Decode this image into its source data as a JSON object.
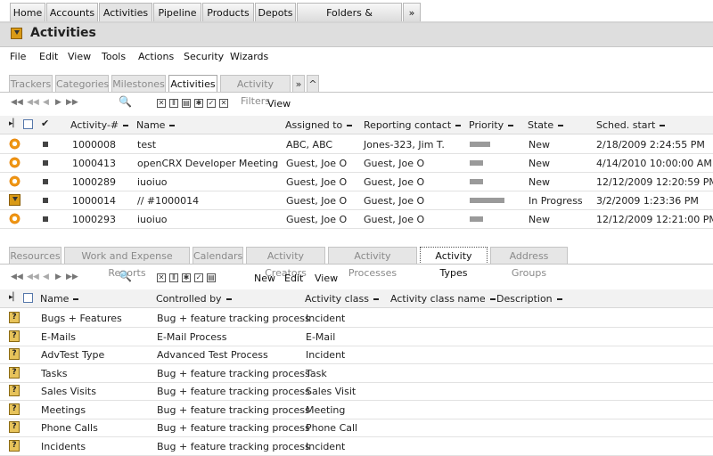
{
  "top_tabs": [
    {
      "label": "Home"
    },
    {
      "label": "Accounts"
    },
    {
      "label": "Activities"
    },
    {
      "label": "Pipeline"
    },
    {
      "label": "Products"
    },
    {
      "label": "Depots"
    },
    {
      "label": "Folders & Documents"
    },
    {
      "label": "»"
    }
  ],
  "header": {
    "title": "Activities"
  },
  "menubar": [
    "File",
    "Edit",
    "View",
    "Tools",
    "Actions",
    "Security",
    "Wizards"
  ],
  "tabs1": [
    "Trackers",
    "Categories",
    "Milestones",
    "Activities",
    "Activity Filters",
    "»",
    "^"
  ],
  "toolbar1": {
    "view_label": "View"
  },
  "grid1": {
    "columns": [
      "Activity-#",
      "Name",
      "Assigned to",
      "Reporting contact",
      "Priority",
      "State",
      "Sched. start"
    ],
    "rows": [
      {
        "num": "1000008",
        "name": "test",
        "assigned": "ABC, ABC",
        "contact": "Jones-323, Jim T.",
        "priority": 3,
        "state": "New",
        "start": "2/18/2009 2:24:55 PM"
      },
      {
        "num": "1000413",
        "name": "openCRX Developer Meeting",
        "assigned": "Guest, Joe O",
        "contact": "Guest, Joe O",
        "priority": 2,
        "state": "New",
        "start": "4/14/2010 10:00:00 AM"
      },
      {
        "num": "1000289",
        "name": "iuoiuo",
        "assigned": "Guest, Joe O",
        "contact": "Guest, Joe O",
        "priority": 2,
        "state": "New",
        "start": "12/12/2009 12:20:59 PM"
      },
      {
        "num": "1000014",
        "name": "// #1000014",
        "assigned": "Guest, Joe O",
        "contact": "Guest, Joe O",
        "priority": 5,
        "state": "In Progress",
        "start": "3/2/2009 1:23:36 PM"
      },
      {
        "num": "1000293",
        "name": "iuoiuo",
        "assigned": "Guest, Joe O",
        "contact": "Guest, Joe O",
        "priority": 2,
        "state": "New",
        "start": "12/12/2009 12:21:00 PM"
      }
    ]
  },
  "tabs2": [
    "Resources",
    "Work and Expense Reports",
    "Calendars",
    "Activity Creators",
    "Activity Processes",
    "Activity Types",
    "Address Groups"
  ],
  "toolbar2": {
    "new_label": "New",
    "edit_label": "Edit",
    "view_label": "View"
  },
  "grid2": {
    "columns": [
      "Name",
      "Controlled by",
      "Activity class",
      "Activity class name",
      "Description"
    ],
    "rows": [
      {
        "name": "Bugs + Features",
        "controlled": "Bug + feature tracking process",
        "cls": "Incident"
      },
      {
        "name": "E-Mails",
        "controlled": "E-Mail Process",
        "cls": "E-Mail"
      },
      {
        "name": "AdvTest Type",
        "controlled": "Advanced Test Process",
        "cls": "Incident"
      },
      {
        "name": "Tasks",
        "controlled": "Bug + feature tracking process",
        "cls": "Task"
      },
      {
        "name": "Sales Visits",
        "controlled": "Bug + feature tracking process",
        "cls": "Sales Visit"
      },
      {
        "name": "Meetings",
        "controlled": "Bug + feature tracking process",
        "cls": "Meeting"
      },
      {
        "name": "Phone Calls",
        "controlled": "Bug + feature tracking process",
        "cls": "Phone Call"
      },
      {
        "name": "Incidents",
        "controlled": "Bug + feature tracking process",
        "cls": "Incident"
      }
    ]
  },
  "colors": {
    "accent": "#e8870c",
    "header_bg": "#dedede"
  }
}
